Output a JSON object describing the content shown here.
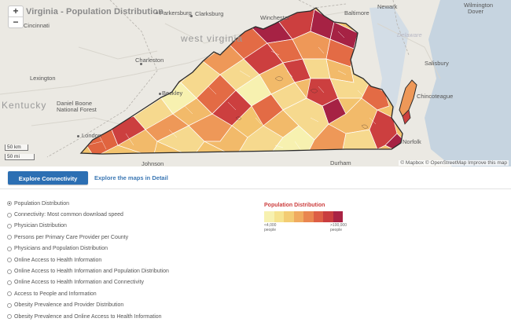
{
  "map": {
    "title": "Virginia - Population Distribution",
    "zoom_in_label": "+",
    "zoom_out_label": "−",
    "scale_km": "50 km",
    "scale_mi": "50 mi",
    "attribution": "© Mapbox © OpenStreetMap Improve this map",
    "places": {
      "cincinnati": "Cincinnati",
      "parkersburg": "Parkersburg",
      "clarksburg": "Clarksburg",
      "winchester": "Winchester",
      "baltimore": "Baltimore",
      "dover": "Dover",
      "lexington": "Lexington",
      "charleston": "Charleston",
      "salisbury": "Salisbury",
      "beckley": "Beckley",
      "london": "London",
      "norfolk": "Norfolk",
      "johnson": "Johnson",
      "west_virginia": "west virginia",
      "kentucky": "Kentucky",
      "delaware": "Delaware",
      "daniel_boone": "Daniel Boone National Forest",
      "newark": "Newark",
      "wilmington": "Wilmington",
      "chincoteague": "Chincoteague",
      "durham": "Durham"
    },
    "shade_scale": [
      "#f7f1b0",
      "#f6d98e",
      "#f2ba6a",
      "#ee9858",
      "#e36b45",
      "#cc3f3f",
      "#a62244"
    ],
    "state_line_color": "#2a2a2a",
    "county_line_color": "#ffffff"
  },
  "actions": {
    "explore_button": "Explore Connectivity Maps",
    "detail_link": "Explore the maps in Detail"
  },
  "layers": {
    "selected_index": 0,
    "items": [
      "Population Distribution",
      "Connectivity: Most common download speed",
      "Physician Distribution",
      "Persons per Primary Care Provider per County",
      "Physicians and Population Distribution",
      "Online Access to Health Information",
      "Online Access to Health Information and Population Distribution",
      "Online Access to Health Information and Connectivity",
      "Access to People and Information",
      "Obesity Prevalence and Provider Distribution",
      "Obesity Prevalence and Online Access to Health Information"
    ]
  },
  "legend": {
    "title": "Population Distribution",
    "low_label_line1": "<4,000",
    "low_label_line2": "people",
    "high_label_line1": ">100,000",
    "high_label_line2": "people",
    "colors": [
      "#f7f1b0",
      "#f6e38f",
      "#f3cc73",
      "#f0ab5f",
      "#e98650",
      "#dd5e45",
      "#c93d3f",
      "#a92344"
    ]
  }
}
